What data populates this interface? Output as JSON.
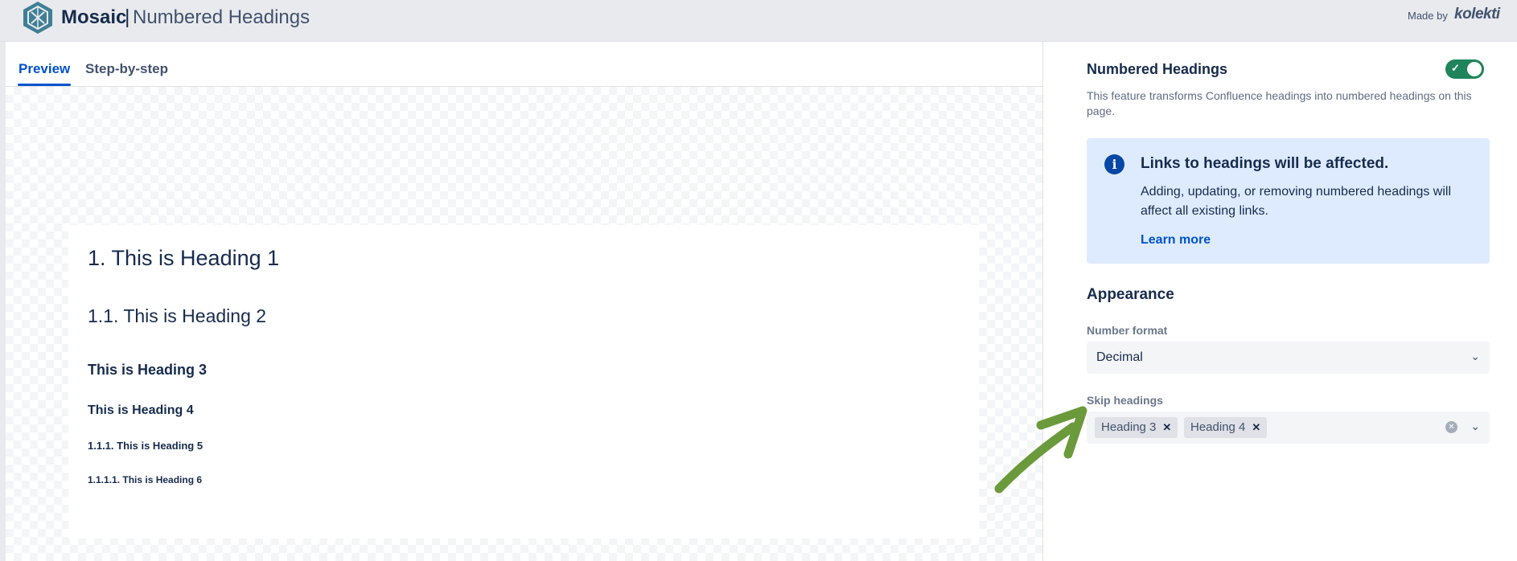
{
  "header": {
    "brand": "Mosaic",
    "separator": "|",
    "app_title": "Numbered Headings",
    "made_by_label": "Made by",
    "made_by_brand": "kolekti"
  },
  "tabs": [
    {
      "label": "Preview",
      "active": true
    },
    {
      "label": "Step-by-step",
      "active": false
    }
  ],
  "preview": {
    "headings": [
      "1. This is Heading 1",
      "1.1. This is Heading 2",
      "This is Heading 3",
      "This is Heading 4",
      "1.1.1. This is Heading 5",
      "1.1.1.1. This is Heading 6"
    ]
  },
  "panel": {
    "title": "Numbered Headings",
    "toggle_on": true,
    "description": "This feature transforms Confluence headings into numbered headings on this page.",
    "info": {
      "icon": "info-icon",
      "title": "Links to headings will be affected.",
      "body": "Adding, updating, or removing numbered headings will affect all existing links.",
      "link": "Learn more"
    },
    "appearance_title": "Appearance",
    "number_format": {
      "label": "Number format",
      "value": "Decimal"
    },
    "skip_headings": {
      "label": "Skip headings",
      "chips": [
        "Heading 3",
        "Heading 4"
      ]
    }
  },
  "colors": {
    "accent": "#0052cc",
    "toggle": "#1f845a",
    "info_bg": "#deebff",
    "annotation_arrow": "#6b9a3c"
  }
}
